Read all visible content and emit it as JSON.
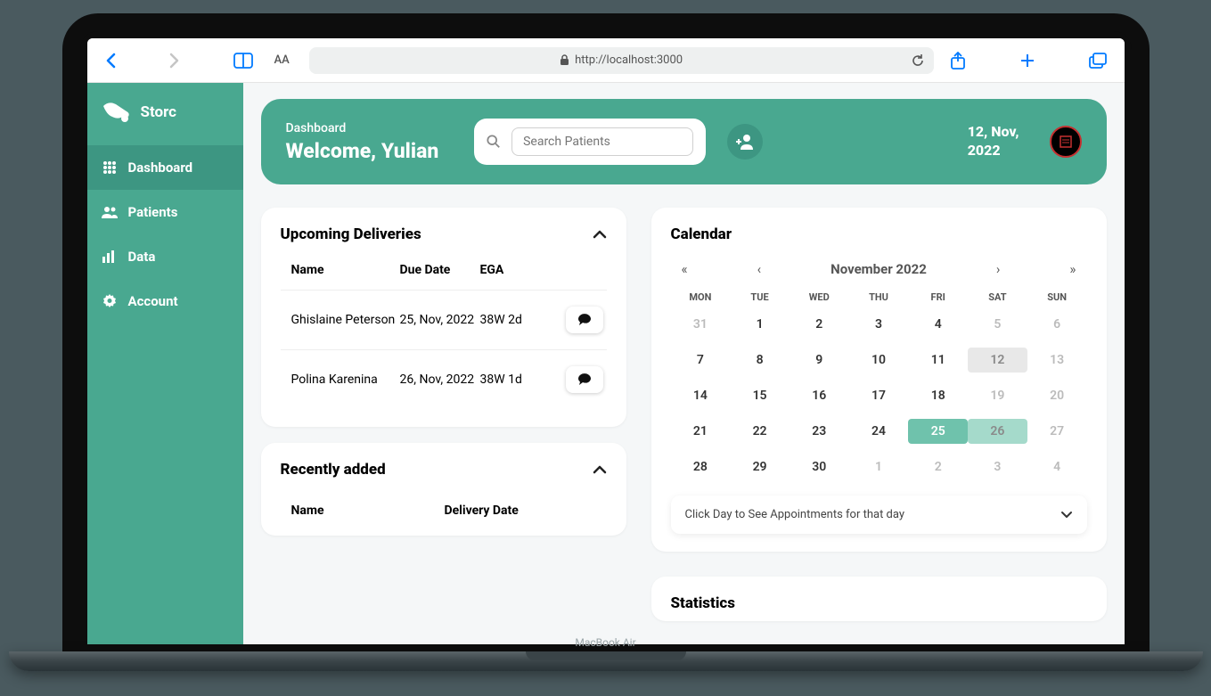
{
  "laptop_label": "MacBook Air",
  "browser": {
    "url": "http://localhost:3000",
    "aa_label": "AA"
  },
  "sidebar": {
    "brand": "Storc",
    "items": [
      {
        "label": "Dashboard"
      },
      {
        "label": "Patients"
      },
      {
        "label": "Data"
      },
      {
        "label": "Account"
      }
    ]
  },
  "header": {
    "section": "Dashboard",
    "welcome": "Welcome, Yulian",
    "search_placeholder": "Search Patients",
    "date_line1": "12, Nov,",
    "date_line2": "2022"
  },
  "upcoming": {
    "title": "Upcoming Deliveries",
    "columns": {
      "name": "Name",
      "due": "Due Date",
      "ega": "EGA"
    },
    "rows": [
      {
        "name": "Ghislaine Peterson",
        "due": "25, Nov, 2022",
        "ega": "38W 2d"
      },
      {
        "name": "Polina Karenina",
        "due": "26, Nov, 2022",
        "ega": "38W 1d"
      }
    ]
  },
  "recent": {
    "title": "Recently added",
    "columns": {
      "name": "Name",
      "delivery": "Delivery Date"
    }
  },
  "calendar": {
    "title": "Calendar",
    "month_label": "November 2022",
    "nav": {
      "prev_year": "«",
      "prev_month": "‹",
      "next_month": "›",
      "next_year": "»"
    },
    "dow": [
      "MON",
      "TUE",
      "WED",
      "THU",
      "FRI",
      "SAT",
      "SUN"
    ],
    "days": [
      {
        "d": "31",
        "cls": "other"
      },
      {
        "d": "1"
      },
      {
        "d": "2"
      },
      {
        "d": "3"
      },
      {
        "d": "4"
      },
      {
        "d": "5",
        "cls": "other"
      },
      {
        "d": "6",
        "cls": "other"
      },
      {
        "d": "7"
      },
      {
        "d": "8"
      },
      {
        "d": "9"
      },
      {
        "d": "10"
      },
      {
        "d": "11"
      },
      {
        "d": "12",
        "cls": "today-ish"
      },
      {
        "d": "13",
        "cls": "other"
      },
      {
        "d": "14"
      },
      {
        "d": "15"
      },
      {
        "d": "16"
      },
      {
        "d": "17"
      },
      {
        "d": "18"
      },
      {
        "d": "19",
        "cls": "other"
      },
      {
        "d": "20",
        "cls": "other"
      },
      {
        "d": "21"
      },
      {
        "d": "22"
      },
      {
        "d": "23"
      },
      {
        "d": "24"
      },
      {
        "d": "25",
        "cls": "hl-strong"
      },
      {
        "d": "26",
        "cls": "hl-soft"
      },
      {
        "d": "27",
        "cls": "other"
      },
      {
        "d": "28"
      },
      {
        "d": "29"
      },
      {
        "d": "30"
      },
      {
        "d": "1",
        "cls": "other"
      },
      {
        "d": "2",
        "cls": "other"
      },
      {
        "d": "3",
        "cls": "other"
      },
      {
        "d": "4",
        "cls": "other"
      }
    ],
    "hint": "Click Day to See Appointments for that day"
  },
  "statistics": {
    "title": "Statistics"
  }
}
